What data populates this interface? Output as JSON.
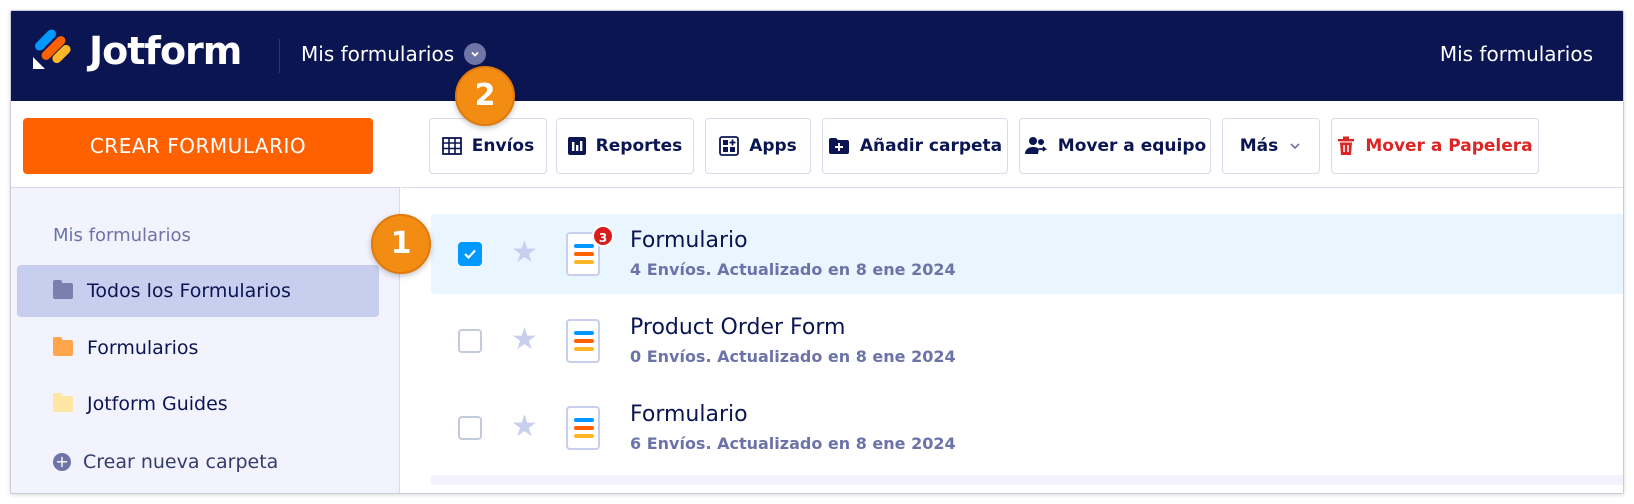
{
  "header": {
    "brand": "Jotform",
    "nav_label": "Mis formularios",
    "right_label": "Mis formularios"
  },
  "sidebar": {
    "create_button": "CREAR FORMULARIO",
    "section_title": "Mis formularios",
    "items": [
      {
        "label": "Todos los Formularios",
        "icon": "folder-icon",
        "color": "#7a80ad",
        "active": true
      },
      {
        "label": "Formularios",
        "icon": "folder-icon",
        "color": "#ffa54a",
        "active": false
      },
      {
        "label": "Jotform Guides",
        "icon": "folder-icon",
        "color": "#ffe6a3",
        "active": false
      }
    ],
    "create_folder": "Crear nueva carpeta"
  },
  "toolbar": {
    "submissions": "Envíos",
    "reports": "Reportes",
    "apps": "Apps",
    "add_folder": "Añadir carpeta",
    "move_team": "Mover a equipo",
    "more": "Más",
    "trash": "Mover a Papelera"
  },
  "forms": [
    {
      "title": "Formulario",
      "subtitle": "4 Envíos. Actualizado en 8 ene 2024",
      "checked": true,
      "badge": "3"
    },
    {
      "title": "Product Order Form",
      "subtitle": "0 Envíos. Actualizado en 8 ene 2024",
      "checked": false,
      "badge": ""
    },
    {
      "title": "Formulario",
      "subtitle": "6 Envíos. Actualizado en 8 ene 2024",
      "checked": false,
      "badge": ""
    }
  ],
  "markers": {
    "step1": "1",
    "step2": "2"
  },
  "colors": {
    "navy": "#0a1551",
    "orange": "#ff6100",
    "selected_row": "#eaf6ff",
    "checkbox": "#0099ff",
    "trash_red": "#dc2626",
    "marker": "#f28c12"
  }
}
